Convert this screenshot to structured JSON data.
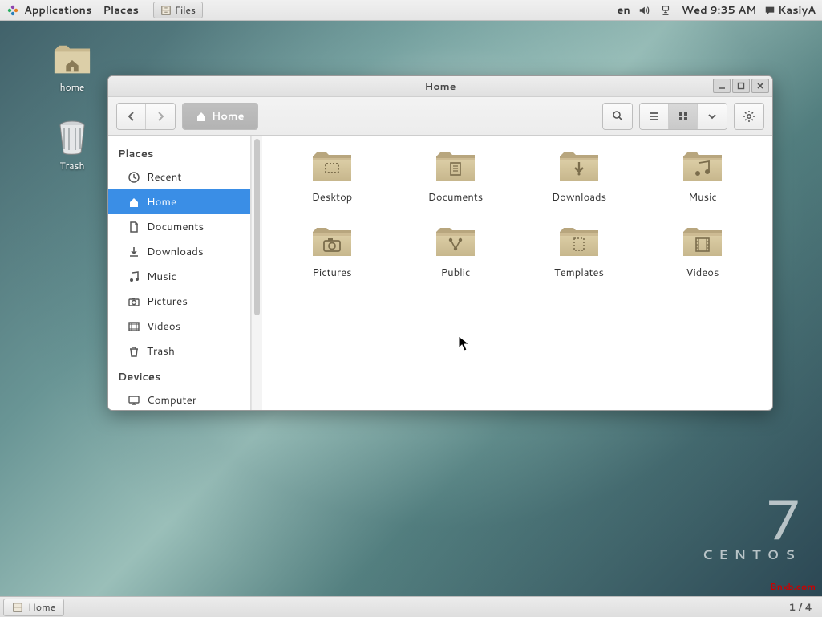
{
  "panel": {
    "applications": "Applications",
    "places": "Places",
    "files_task": "Files",
    "lang": "en",
    "datetime": "Wed  9:35 AM",
    "user": "KasiyA"
  },
  "desktop_icons": {
    "home": "home",
    "trash": "Trash"
  },
  "fm": {
    "title": "Home",
    "path_label": "Home",
    "sidebar": {
      "places_header": "Places",
      "devices_header": "Devices",
      "items": [
        {
          "label": "Recent",
          "icon": "clock"
        },
        {
          "label": "Home",
          "icon": "home"
        },
        {
          "label": "Documents",
          "icon": "document"
        },
        {
          "label": "Downloads",
          "icon": "download"
        },
        {
          "label": "Music",
          "icon": "music"
        },
        {
          "label": "Pictures",
          "icon": "camera"
        },
        {
          "label": "Videos",
          "icon": "video"
        },
        {
          "label": "Trash",
          "icon": "trash"
        }
      ],
      "devices": [
        {
          "label": "Computer",
          "icon": "computer"
        }
      ]
    },
    "content": [
      {
        "label": "Desktop",
        "glyph": "desktop"
      },
      {
        "label": "Documents",
        "glyph": "document"
      },
      {
        "label": "Downloads",
        "glyph": "download"
      },
      {
        "label": "Music",
        "glyph": "music"
      },
      {
        "label": "Pictures",
        "glyph": "camera"
      },
      {
        "label": "Public",
        "glyph": "share"
      },
      {
        "label": "Templates",
        "glyph": "template"
      },
      {
        "label": "Videos",
        "glyph": "film"
      }
    ]
  },
  "brand": {
    "version": "7",
    "name": "CENTOS"
  },
  "watermark": "Bnxb.com",
  "bottom": {
    "task": "Home",
    "workspace": "1 / 4"
  }
}
